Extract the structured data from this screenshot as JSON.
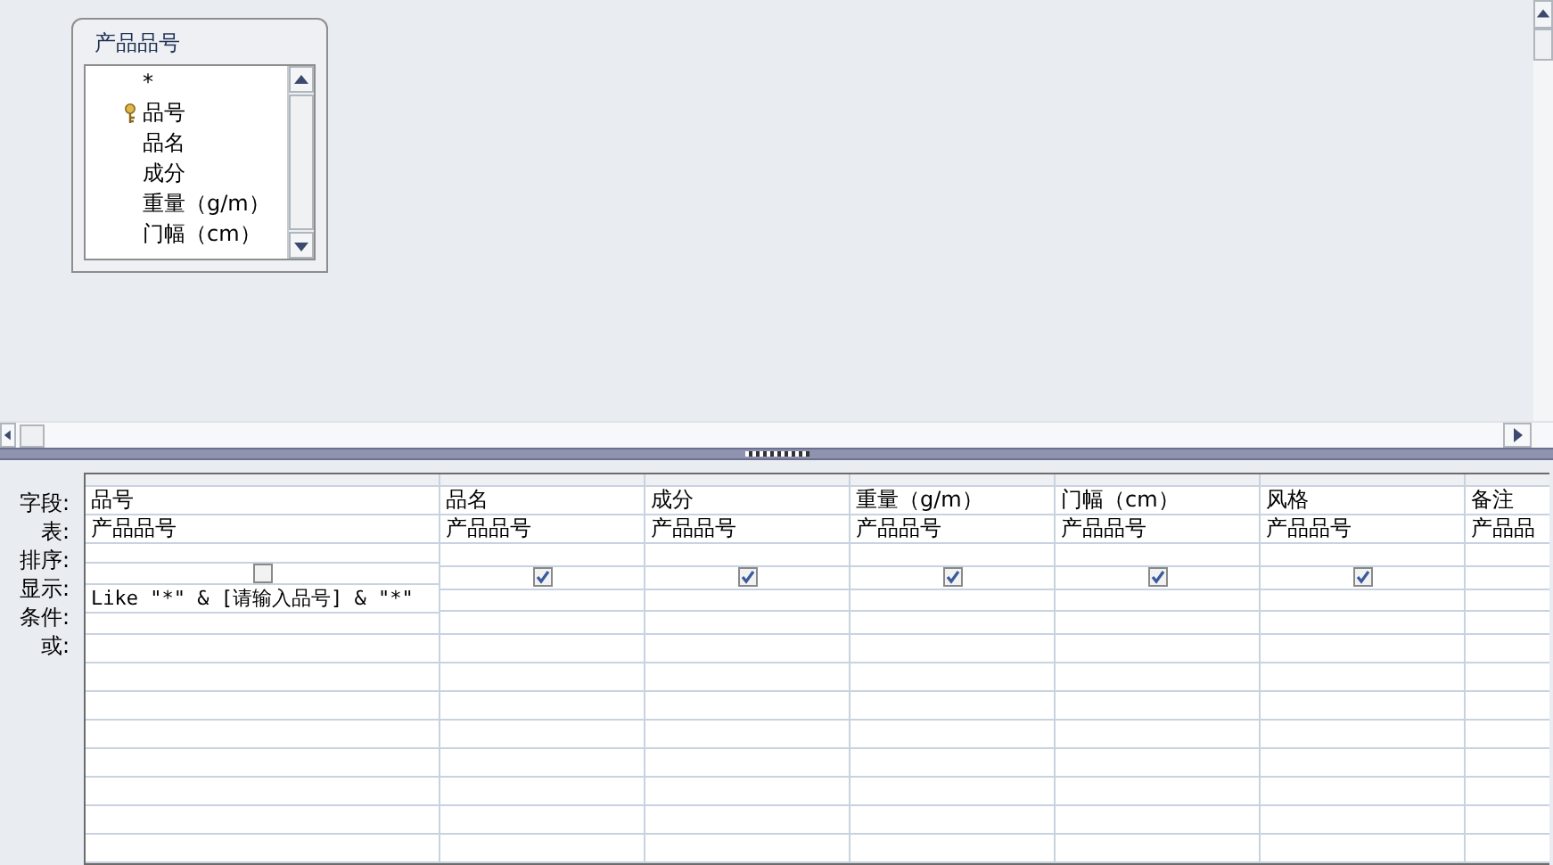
{
  "field_list": {
    "title": "产品品号",
    "fields": [
      {
        "name": "*",
        "primary_key": false
      },
      {
        "name": "品号",
        "primary_key": true
      },
      {
        "name": "品名",
        "primary_key": false
      },
      {
        "name": "成分",
        "primary_key": false
      },
      {
        "name": "重量（g/m）",
        "primary_key": false
      },
      {
        "name": "门幅（cm）",
        "primary_key": false
      }
    ]
  },
  "grid": {
    "row_labels": [
      "字段:",
      "表:",
      "排序:",
      "显示:",
      "条件:",
      "或:"
    ],
    "columns": [
      {
        "field": "品号",
        "table": "产品品号",
        "show": false,
        "criteria": "Like \"*\" & [请输入品号] & \"*\""
      },
      {
        "field": "品名",
        "table": "产品品号",
        "show": true
      },
      {
        "field": "成分",
        "table": "产品品号",
        "show": true
      },
      {
        "field": "重量（g/m）",
        "table": "产品品号",
        "show": true
      },
      {
        "field": "门幅（cm）",
        "table": "产品品号",
        "show": true
      },
      {
        "field": "风格",
        "table": "产品品号",
        "show": true
      },
      {
        "field": "备注",
        "table": "产品品"
      }
    ]
  }
}
